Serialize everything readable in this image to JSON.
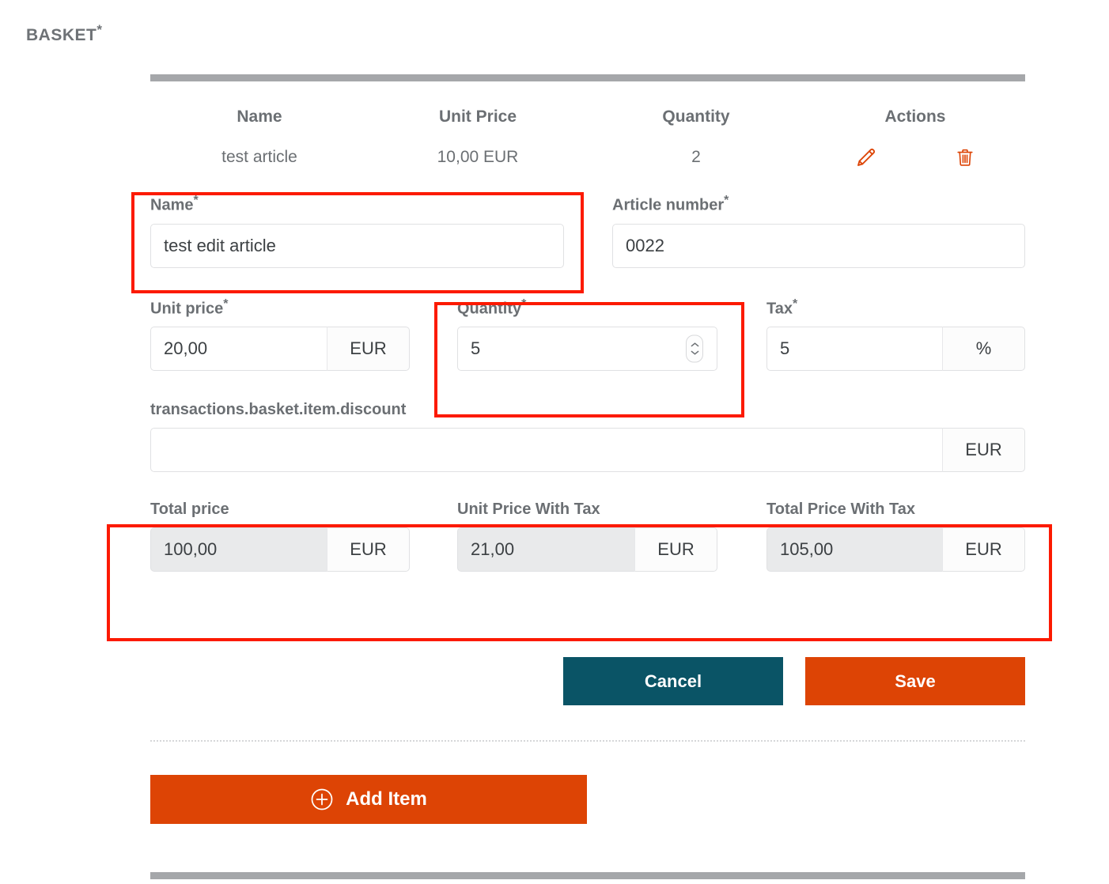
{
  "section": {
    "title": "BASKET",
    "required_marker": "*"
  },
  "table": {
    "headers": [
      "Name",
      "Unit Price",
      "Quantity",
      "Actions"
    ],
    "row": {
      "name": "test article",
      "unit_price": "10,00 EUR",
      "quantity": "2"
    },
    "actions": {
      "edit_icon": "pencil-icon",
      "delete_icon": "trash-icon",
      "icon_color": "#dd4405"
    }
  },
  "form": {
    "name": {
      "label": "Name",
      "required_marker": "*",
      "value": "test edit article",
      "highlighted": true
    },
    "article_number": {
      "label": "Article number",
      "required_marker": "*",
      "value": "0022"
    },
    "unit_price": {
      "label": "Unit price",
      "required_marker": "*",
      "value": "20,00",
      "suffix": "EUR"
    },
    "quantity": {
      "label": "Quantity",
      "required_marker": "*",
      "value": "5",
      "spinner_icon": "number-spinner-icon",
      "highlighted": true
    },
    "tax": {
      "label": "Tax",
      "required_marker": "*",
      "value": "5",
      "suffix": "%"
    },
    "discount": {
      "label": "transactions.basket.item.discount",
      "value": "",
      "suffix": "EUR"
    },
    "total_price": {
      "label": "Total price",
      "value": "100,00",
      "suffix": "EUR",
      "readonly": true
    },
    "unit_price_with_tax": {
      "label": "Unit Price With Tax",
      "value": "21,00",
      "suffix": "EUR",
      "readonly": true
    },
    "total_price_with_tax": {
      "label": "Total Price With Tax",
      "value": "105,00",
      "suffix": "EUR",
      "readonly": true
    },
    "totals_highlighted": true
  },
  "buttons": {
    "cancel": "Cancel",
    "save": "Save",
    "add_item": "Add Item",
    "add_item_icon": "plus-circle-icon"
  },
  "colors": {
    "accent_orange": "#dd4405",
    "teal": "#0a5466",
    "highlight_red": "#fc1a00",
    "rule_gray": "#a5a7aa",
    "text_gray": "#6b6f73"
  }
}
